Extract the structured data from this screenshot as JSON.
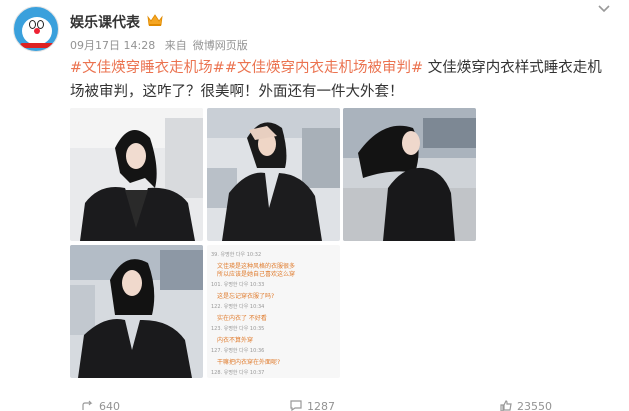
{
  "post": {
    "username": "娱乐课代表",
    "date": "09月17日 14:28",
    "source_prefix": "来自",
    "source": "微博网页版",
    "hashtag1": "#文佳煐穿睡衣走机场#",
    "hashtag2": "#文佳煐穿内衣走机场被审判#",
    "body": " 文佳煐穿内衣样式睡衣走机场被审判，这咋了？很美啊！外面还有一件大外套！"
  },
  "comments_image": {
    "lines": [
      {
        "kind": "meta",
        "text": "39. 유명한 다우 10:32"
      },
      {
        "kind": "hl",
        "text": "文佳瑛是这种风格的衣服很多"
      },
      {
        "kind": "hl",
        "text": "所以应该是她自己喜欢这么穿"
      },
      {
        "kind": "meta",
        "text": "101. 유명한 다우 10:33"
      },
      {
        "kind": "hl",
        "text": "这是忘记穿衣服了吗?"
      },
      {
        "kind": "meta",
        "text": "122. 유명한 다우 10:34"
      },
      {
        "kind": "hl",
        "text": "实在内衣了 不好看"
      },
      {
        "kind": "meta",
        "text": "123. 유명한 다우 10:35"
      },
      {
        "kind": "hl",
        "text": "内衣不算外穿"
      },
      {
        "kind": "meta",
        "text": "127. 유명한 다우 10:36"
      },
      {
        "kind": "hl",
        "text": "干嘛把内衣穿在外面呢?"
      },
      {
        "kind": "meta",
        "text": "128. 유명한 다우 10:37"
      }
    ]
  },
  "actions": {
    "forward_count": "640",
    "comment_count": "1287",
    "like_count": "23550"
  },
  "colors": {
    "link": "#eb7350",
    "meta_text": "#939393"
  }
}
